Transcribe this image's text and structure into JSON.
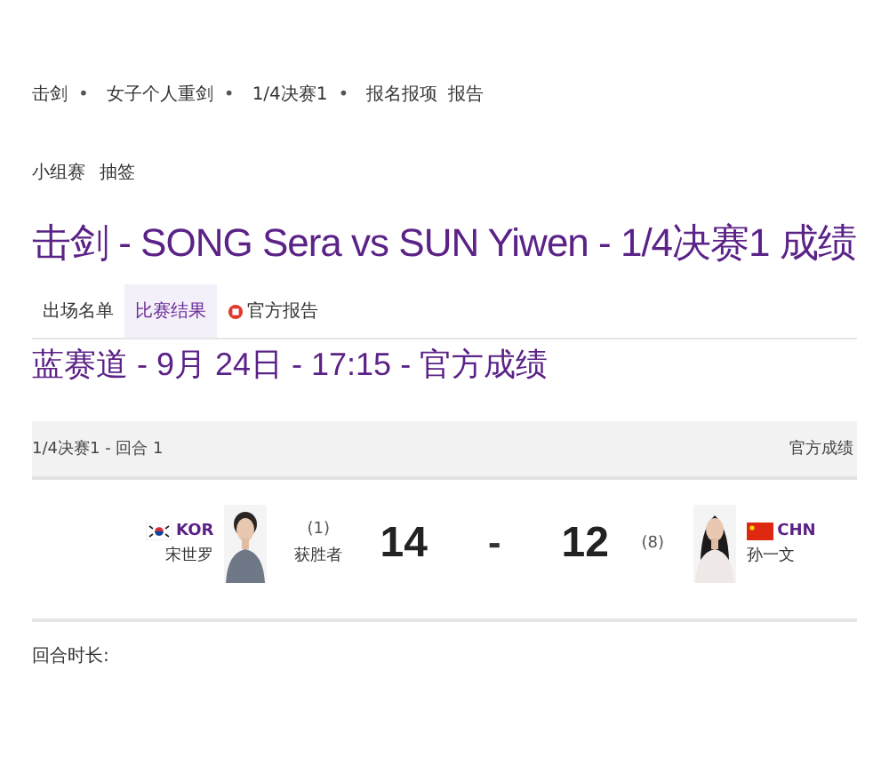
{
  "breadcrumb": [
    {
      "label": "击剑",
      "separator": "•"
    },
    {
      "label": "女子个人重剑",
      "separator": "•"
    },
    {
      "label": "1/4决赛1",
      "separator": "•"
    },
    {
      "label": "报名报项"
    },
    {
      "label": "报告"
    }
  ],
  "subnav": [
    "小组赛",
    "抽签"
  ],
  "title": "击剑 - SONG Sera vs SUN Yiwen - 1/4决赛1 成绩",
  "tabs": [
    {
      "label": "出场名单",
      "selected": false,
      "kind": "plain"
    },
    {
      "label": "比赛结果",
      "selected": true,
      "kind": "plain"
    },
    {
      "label": "官方报告",
      "selected": false,
      "kind": "document"
    }
  ],
  "subtitle": "蓝赛道 - 9月 24日 - 17:15 - 官方成绩",
  "bout": {
    "header": "1/4决赛1 - 回合 1",
    "status": "官方成绩",
    "left": {
      "kind": "korea",
      "noc": "KOR",
      "name": "宋世罗",
      "seed": "(1)",
      "result": "获胜者",
      "score": "14"
    },
    "dash": "-",
    "right": {
      "kind": "china",
      "noc": "CHN",
      "name": "孙一文",
      "seed": "(8)",
      "score": "12"
    }
  },
  "duration_label": "回合时长:"
}
